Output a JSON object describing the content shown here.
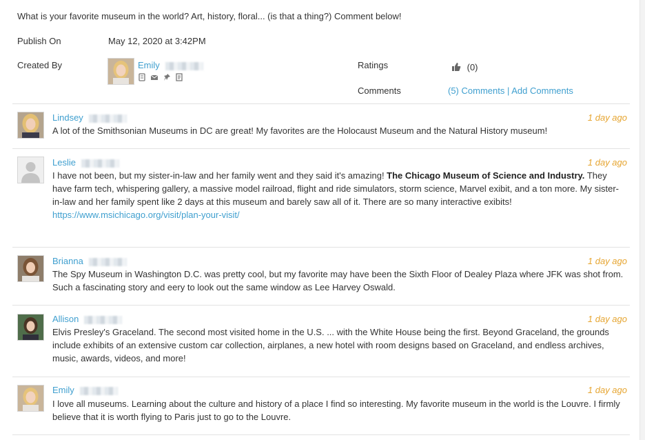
{
  "post": {
    "question": "What is your favorite museum in the world? Art, history, floral... (is that a thing?) Comment below!",
    "publish_label": "Publish On",
    "publish_value": "May 12, 2020 at 3:42PM",
    "created_label": "Created By",
    "creator_name": "Emily",
    "ratings_label": "Ratings",
    "ratings_count": "(0)",
    "comments_label": "Comments",
    "comments_link": "(5) Comments",
    "comments_sep": " | ",
    "add_comments": "Add Comments",
    "creator_icons": [
      "contact-card-icon",
      "email-icon",
      "pin-icon",
      "note-icon"
    ]
  },
  "comments": [
    {
      "name": "Lindsey",
      "time": "1 day ago",
      "text": "A lot of the Smithsonian Museums in DC are great! My favorites are the Holocaust Museum and the Natural History museum!"
    },
    {
      "name": "Leslie",
      "time": "1 day ago",
      "text_a": "I have not been, but my sister-in-law and her family went and they said it's amazing! ",
      "bold": "The Chicago Museum of Science and Industry.",
      "text_b": " They have farm tech, whispering gallery, a massive model railroad, flight and ride simulators, storm science, Marvel exibit, and a ton more. My sister-in-law and her family spent like 2 days at this museum and barely saw all of it. There are so many interactive exibits!",
      "link": "https://www.msichicago.org/visit/plan-your-visit/"
    },
    {
      "name": "Brianna",
      "time": "1 day ago",
      "text": "The Spy Museum in Washington D.C. was pretty cool, but my favorite may have been the Sixth Floor of Dealey Plaza where JFK was shot from. Such a fascinating story and eery to look out the same window as Lee Harvey Oswald."
    },
    {
      "name": "Allison",
      "time": "1 day ago",
      "text": "Elvis Presley's Graceland.  The second most visited home in the U.S. ... with the White House being the first.  Beyond Graceland, the grounds include exhibits of an extensive custom car collection, airplanes, a new hotel with room designs based on Graceland, and endless archives, music, awards, videos, and more!"
    },
    {
      "name": "Emily",
      "time": "1 day ago",
      "text": "I love all museums. Learning about the culture and history of a place I find so interesting. My favorite museum in the world is the Louvre. I firmly believe that it is worth flying to Paris just to go to the Louvre."
    }
  ]
}
